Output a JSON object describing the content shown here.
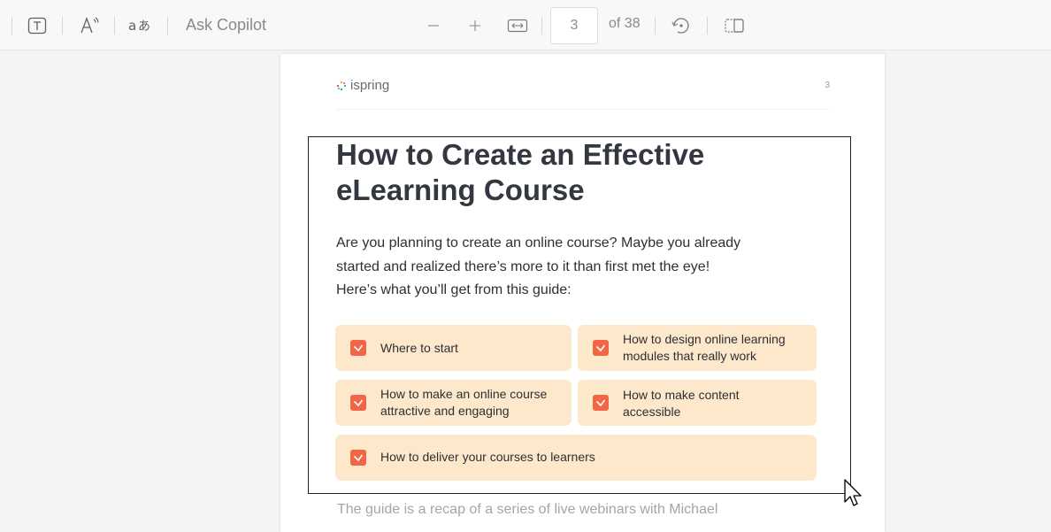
{
  "toolbar": {
    "ask_copilot": "Ask Copilot",
    "page_number": "3",
    "page_of": "of 38"
  },
  "page": {
    "logo_text": "ispring",
    "page_number_label": "3",
    "title_line1": "How to Create an Effective",
    "title_line2": "eLearning Course",
    "intro_line1": "Are you planning to create an online course? Maybe you already",
    "intro_line2": "started and realized there’s more to it than first met the eye!",
    "intro_line3": "Here’s what you’ll get from this guide:",
    "cards": [
      {
        "line1": "Where to start",
        "line2": ""
      },
      {
        "line1": "How to design online learning",
        "line2": "modules that really work"
      },
      {
        "line1": "How to make an online course",
        "line2": "attractive and engaging"
      },
      {
        "line1": "How to make content",
        "line2": "accessible"
      },
      {
        "line1": "How to deliver your courses to learners",
        "line2": ""
      }
    ],
    "footer_partial": "The guide is a recap of a series of live webinars with Michael"
  },
  "colors": {
    "accent_check": "#f26647",
    "card_bg": "#fde8cc",
    "title": "#333740"
  },
  "icons": [
    "text-icon",
    "read-aloud-icon",
    "translate-icon",
    "zoom-out-icon",
    "zoom-in-icon",
    "fit-width-icon",
    "rotate-icon",
    "two-page-view-icon",
    "checkbox-checked-icon",
    "mouse-cursor-icon"
  ]
}
